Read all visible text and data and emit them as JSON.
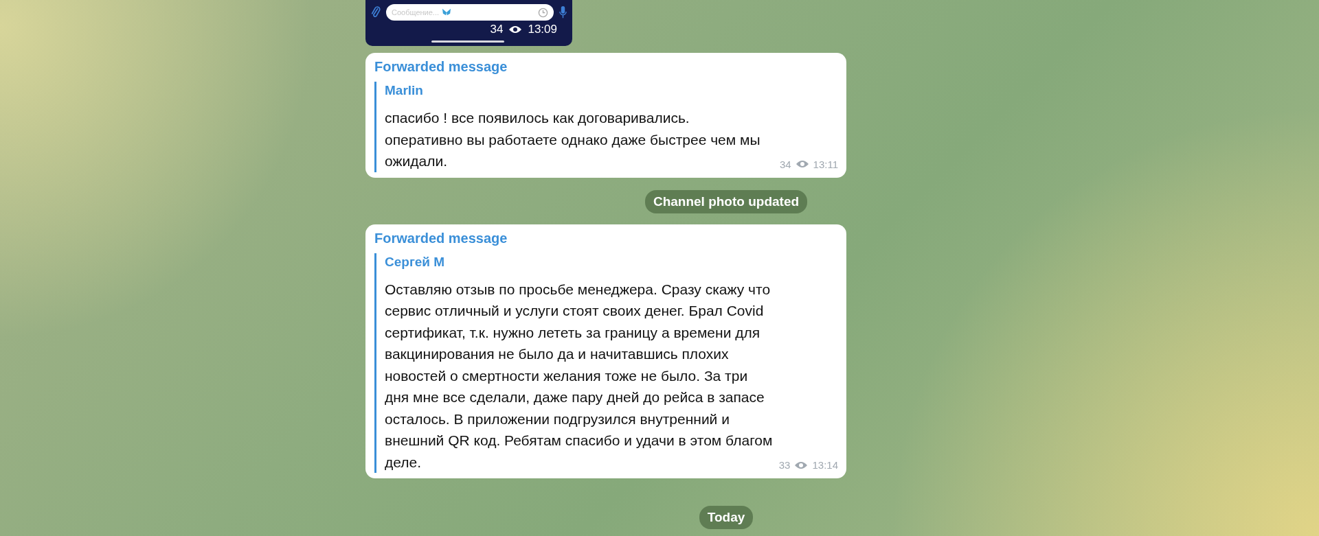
{
  "messages": [
    {
      "kind": "screenshot",
      "placeholder": "Сообщение...",
      "views": "34",
      "time": "13:09"
    },
    {
      "kind": "forwarded",
      "header": "Forwarded message",
      "author": "Marlin",
      "text": "спасибо ! все появилось как договаривались.\nоперативно вы работаете однако даже быстрее чем мы\nожидали.",
      "views": "34",
      "time": "13:11"
    },
    {
      "kind": "service",
      "text": "Channel photo updated"
    },
    {
      "kind": "forwarded",
      "header": "Forwarded message",
      "author": "Сергей М",
      "text": "Оставляю отзыв по просьбе менеджера. Сразу скажу что\nсервис отличный и услуги стоят своих денег. Брал Covid\nсертификат, т.к. нужно лететь за границу а времени для\nвакцинирования не было да и начитавшись плохих\nновостей о смертности желания тоже не было. За три\nдня мне все сделали, даже пару дней до рейса в запасе\nосталось. В приложении подгрузился внутренний и\nвнешний QR код. Ребятам спасибо и удачи в этом благом\nделе.",
      "views": "33",
      "time": "13:14"
    },
    {
      "kind": "service",
      "text": "Today"
    }
  ]
}
